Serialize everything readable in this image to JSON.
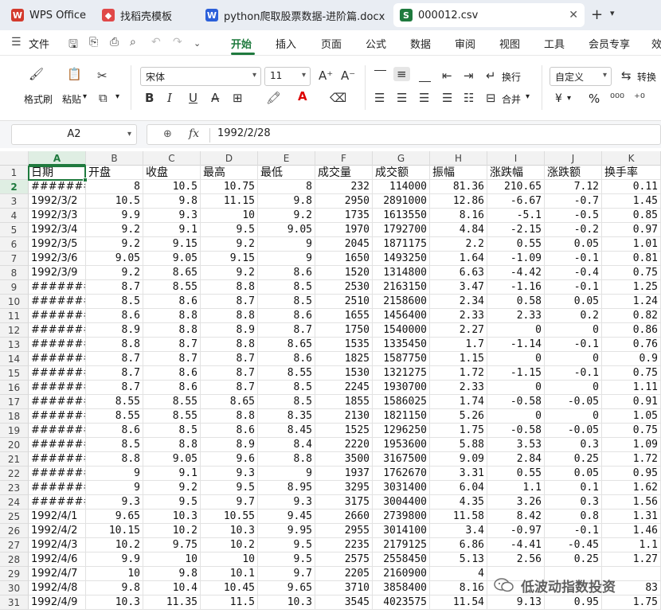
{
  "tabs": [
    {
      "label": "WPS Office",
      "icon": "wps-logo-icon",
      "color": "#d33a2c"
    },
    {
      "label": "找稻壳模板",
      "icon": "docer-icon",
      "color": "#e04848"
    },
    {
      "label": "python爬取股票数据-进阶篇.docx",
      "icon": "word-doc-icon",
      "color": "#2b5fd9"
    },
    {
      "label": "000012.csv",
      "icon": "spreadsheet-icon",
      "color": "#1f7a3e",
      "active": true
    }
  ],
  "menu": {
    "file": "文件",
    "items": [
      "开始",
      "插入",
      "页面",
      "公式",
      "数据",
      "审阅",
      "视图",
      "工具",
      "会员专享",
      "效"
    ],
    "active": "开始"
  },
  "ribbon": {
    "format_painter": "格式刷",
    "paste": "粘贴",
    "font_name": "宋体",
    "font_size": "11",
    "wrap": "换行",
    "merge": "合并",
    "number_format": "自定义",
    "convert": "转换",
    "percent": "%",
    "currency": "¥"
  },
  "formula_bar": {
    "name_box": "A2",
    "fx_label": "fx",
    "content": "1992/2/28"
  },
  "columns": [
    "A",
    "B",
    "C",
    "D",
    "E",
    "F",
    "G",
    "H",
    "I",
    "J",
    "K"
  ],
  "selected_column": "A",
  "selected_row": 2,
  "header_row": [
    "日期",
    "开盘",
    "收盘",
    "最高",
    "最低",
    "成交量",
    "成交额",
    "振幅",
    "涨跌幅",
    "涨跌额",
    "换手率"
  ],
  "rows": [
    {
      "n": 2,
      "v": [
        "########",
        "8",
        "10.5",
        "10.75",
        "8",
        "232",
        "114000",
        "81.36",
        "210.65",
        "7.12",
        "0.11"
      ]
    },
    {
      "n": 3,
      "v": [
        "1992/3/2",
        "10.5",
        "9.8",
        "11.15",
        "9.8",
        "2950",
        "2891000",
        "12.86",
        "-6.67",
        "-0.7",
        "1.45"
      ]
    },
    {
      "n": 4,
      "v": [
        "1992/3/3",
        "9.9",
        "9.3",
        "10",
        "9.2",
        "1735",
        "1613550",
        "8.16",
        "-5.1",
        "-0.5",
        "0.85"
      ]
    },
    {
      "n": 5,
      "v": [
        "1992/3/4",
        "9.2",
        "9.1",
        "9.5",
        "9.05",
        "1970",
        "1792700",
        "4.84",
        "-2.15",
        "-0.2",
        "0.97"
      ]
    },
    {
      "n": 6,
      "v": [
        "1992/3/5",
        "9.2",
        "9.15",
        "9.2",
        "9",
        "2045",
        "1871175",
        "2.2",
        "0.55",
        "0.05",
        "1.01"
      ]
    },
    {
      "n": 7,
      "v": [
        "1992/3/6",
        "9.05",
        "9.05",
        "9.15",
        "9",
        "1650",
        "1493250",
        "1.64",
        "-1.09",
        "-0.1",
        "0.81"
      ]
    },
    {
      "n": 8,
      "v": [
        "1992/3/9",
        "9.2",
        "8.65",
        "9.2",
        "8.6",
        "1520",
        "1314800",
        "6.63",
        "-4.42",
        "-0.4",
        "0.75"
      ]
    },
    {
      "n": 9,
      "v": [
        "########",
        "8.7",
        "8.55",
        "8.8",
        "8.5",
        "2530",
        "2163150",
        "3.47",
        "-1.16",
        "-0.1",
        "1.25"
      ]
    },
    {
      "n": 10,
      "v": [
        "########",
        "8.5",
        "8.6",
        "8.7",
        "8.5",
        "2510",
        "2158600",
        "2.34",
        "0.58",
        "0.05",
        "1.24"
      ]
    },
    {
      "n": 11,
      "v": [
        "########",
        "8.6",
        "8.8",
        "8.8",
        "8.6",
        "1655",
        "1456400",
        "2.33",
        "2.33",
        "0.2",
        "0.82"
      ]
    },
    {
      "n": 12,
      "v": [
        "########",
        "8.9",
        "8.8",
        "8.9",
        "8.7",
        "1750",
        "1540000",
        "2.27",
        "0",
        "0",
        "0.86"
      ]
    },
    {
      "n": 13,
      "v": [
        "########",
        "8.8",
        "8.7",
        "8.8",
        "8.65",
        "1535",
        "1335450",
        "1.7",
        "-1.14",
        "-0.1",
        "0.76"
      ]
    },
    {
      "n": 14,
      "v": [
        "########",
        "8.7",
        "8.7",
        "8.7",
        "8.6",
        "1825",
        "1587750",
        "1.15",
        "0",
        "0",
        "0.9"
      ]
    },
    {
      "n": 15,
      "v": [
        "########",
        "8.7",
        "8.6",
        "8.7",
        "8.55",
        "1530",
        "1321275",
        "1.72",
        "-1.15",
        "-0.1",
        "0.75"
      ]
    },
    {
      "n": 16,
      "v": [
        "########",
        "8.7",
        "8.6",
        "8.7",
        "8.5",
        "2245",
        "1930700",
        "2.33",
        "0",
        "0",
        "1.11"
      ]
    },
    {
      "n": 17,
      "v": [
        "########",
        "8.55",
        "8.55",
        "8.65",
        "8.5",
        "1855",
        "1586025",
        "1.74",
        "-0.58",
        "-0.05",
        "0.91"
      ]
    },
    {
      "n": 18,
      "v": [
        "########",
        "8.55",
        "8.55",
        "8.8",
        "8.35",
        "2130",
        "1821150",
        "5.26",
        "0",
        "0",
        "1.05"
      ]
    },
    {
      "n": 19,
      "v": [
        "########",
        "8.6",
        "8.5",
        "8.6",
        "8.45",
        "1525",
        "1296250",
        "1.75",
        "-0.58",
        "-0.05",
        "0.75"
      ]
    },
    {
      "n": 20,
      "v": [
        "########",
        "8.5",
        "8.8",
        "8.9",
        "8.4",
        "2220",
        "1953600",
        "5.88",
        "3.53",
        "0.3",
        "1.09"
      ]
    },
    {
      "n": 21,
      "v": [
        "########",
        "8.8",
        "9.05",
        "9.6",
        "8.8",
        "3500",
        "3167500",
        "9.09",
        "2.84",
        "0.25",
        "1.72"
      ]
    },
    {
      "n": 22,
      "v": [
        "########",
        "9",
        "9.1",
        "9.3",
        "9",
        "1937",
        "1762670",
        "3.31",
        "0.55",
        "0.05",
        "0.95"
      ]
    },
    {
      "n": 23,
      "v": [
        "########",
        "9",
        "9.2",
        "9.5",
        "8.95",
        "3295",
        "3031400",
        "6.04",
        "1.1",
        "0.1",
        "1.62"
      ]
    },
    {
      "n": 24,
      "v": [
        "########",
        "9.3",
        "9.5",
        "9.7",
        "9.3",
        "3175",
        "3004400",
        "4.35",
        "3.26",
        "0.3",
        "1.56"
      ]
    },
    {
      "n": 25,
      "v": [
        "1992/4/1",
        "9.65",
        "10.3",
        "10.55",
        "9.45",
        "2660",
        "2739800",
        "11.58",
        "8.42",
        "0.8",
        "1.31"
      ]
    },
    {
      "n": 26,
      "v": [
        "1992/4/2",
        "10.15",
        "10.2",
        "10.3",
        "9.95",
        "2955",
        "3014100",
        "3.4",
        "-0.97",
        "-0.1",
        "1.46"
      ]
    },
    {
      "n": 27,
      "v": [
        "1992/4/3",
        "10.2",
        "9.75",
        "10.2",
        "9.5",
        "2235",
        "2179125",
        "6.86",
        "-4.41",
        "-0.45",
        "1.1"
      ]
    },
    {
      "n": 28,
      "v": [
        "1992/4/6",
        "9.9",
        "10",
        "10",
        "9.5",
        "2575",
        "2558450",
        "5.13",
        "2.56",
        "0.25",
        "1.27"
      ]
    },
    {
      "n": 29,
      "v": [
        "1992/4/7",
        "10",
        "9.8",
        "10.1",
        "9.7",
        "2205",
        "2160900",
        "4",
        "",
        "",
        ""
      ]
    },
    {
      "n": 30,
      "v": [
        "1992/4/8",
        "9.8",
        "10.4",
        "10.45",
        "9.65",
        "3710",
        "3858400",
        "8.16",
        "",
        "",
        "83"
      ]
    },
    {
      "n": 31,
      "v": [
        "1992/4/9",
        "10.3",
        "11.35",
        "11.5",
        "10.3",
        "3545",
        "4023575",
        "11.54",
        "9.13",
        "0.95",
        "1.75"
      ]
    }
  ],
  "watermark": {
    "text": "低波动指数投资",
    "icon": "wechat-official-account-icon"
  }
}
